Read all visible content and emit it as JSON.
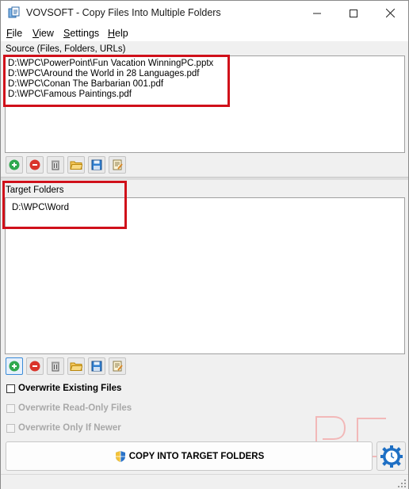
{
  "window": {
    "title": "VOVSOFT - Copy Files Into Multiple Folders",
    "controls": [
      "minimize",
      "maximize",
      "close"
    ]
  },
  "menu": [
    {
      "key": "F",
      "rest": "ile"
    },
    {
      "key": "V",
      "rest": "iew"
    },
    {
      "key": "S",
      "rest": "ettings"
    },
    {
      "key": "H",
      "rest": "elp"
    }
  ],
  "source": {
    "label": "Source (Files, Folders, URLs)",
    "items": [
      "D:\\WPC\\PowerPoint\\Fun Vacation WinningPC.pptx",
      "D:\\WPC\\Around the World in 28 Languages.pdf",
      "D:\\WPC\\Conan The Barbarian 001.pdf",
      "D:\\WPC\\Famous Paintings.pdf"
    ]
  },
  "target": {
    "label": "Target Folders",
    "items": [
      "D:\\WPC\\Word"
    ]
  },
  "toolbar_icons": [
    "add-icon",
    "remove-icon",
    "clear-icon",
    "open-folder-icon",
    "save-icon",
    "edit-icon"
  ],
  "options": {
    "overwrite_existing": "Overwrite Existing Files",
    "overwrite_readonly": "Overwrite Read-Only Files",
    "overwrite_newer": "Overwrite Only If Newer"
  },
  "actions": {
    "copy_label": "COPY INTO TARGET FOLDERS"
  },
  "colors": {
    "highlight": "#d0101a",
    "add_green": "#2fa84f",
    "remove_red": "#d9342b",
    "accent_blue": "#1e6fc4"
  }
}
